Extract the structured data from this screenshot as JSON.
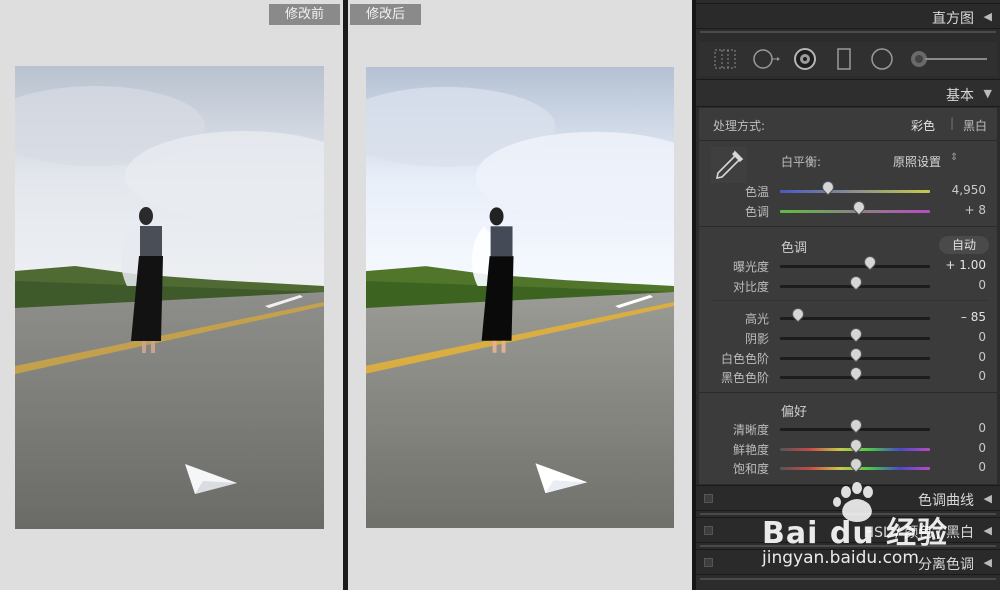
{
  "compare": {
    "before_label": "修改前",
    "after_label": "修改后"
  },
  "panel": {
    "histogram": "直方图",
    "basic": "基本",
    "treatment_label": "处理方式:",
    "treatment_color": "彩色",
    "treatment_separator": "|",
    "treatment_bw": "黑白",
    "wb_label": "白平衡:",
    "wb_value": "原照设置",
    "wb_arrows": "⇕",
    "temp_label": "色温",
    "temp_value": "4,950",
    "temp_pos": 0.31,
    "tint_label": "色调",
    "tint_value": "+ 8",
    "tint_pos": 0.52,
    "tone_title": "色调",
    "auto_label": "自动",
    "exposure_label": "曝光度",
    "exposure_value": "+ 1.00",
    "exposure_pos": 0.59,
    "contrast_label": "对比度",
    "contrast_value": "0",
    "contrast_pos": 0.5,
    "highlights_label": "高光",
    "highlights_value": "– 85",
    "highlights_pos": 0.11,
    "shadows_label": "阴影",
    "shadows_value": "0",
    "shadows_pos": 0.5,
    "whites_label": "白色色阶",
    "whites_value": "0",
    "whites_pos": 0.5,
    "blacks_label": "黑色色阶",
    "blacks_value": "0",
    "blacks_pos": 0.5,
    "presence_title": "偏好",
    "clarity_label": "清晰度",
    "clarity_value": "0",
    "clarity_pos": 0.5,
    "vibrance_label": "鲜艳度",
    "vibrance_value": "0",
    "vibrance_pos": 0.5,
    "saturation_label": "饱和度",
    "saturation_value": "0",
    "saturation_pos": 0.5,
    "tone_curve": "色调曲线",
    "hsl": "HSL / 颜色 / 黑白",
    "split_toning": "分离色调"
  },
  "watermark": {
    "brand": "Bai du 经验",
    "url": "jingyan.baidu.com"
  },
  "colors": {
    "panel_bg": "#2c2c2c",
    "section_bg": "#3b3b3b",
    "compare_bg": "#dedede",
    "label_bg": "#8a8a8a"
  }
}
